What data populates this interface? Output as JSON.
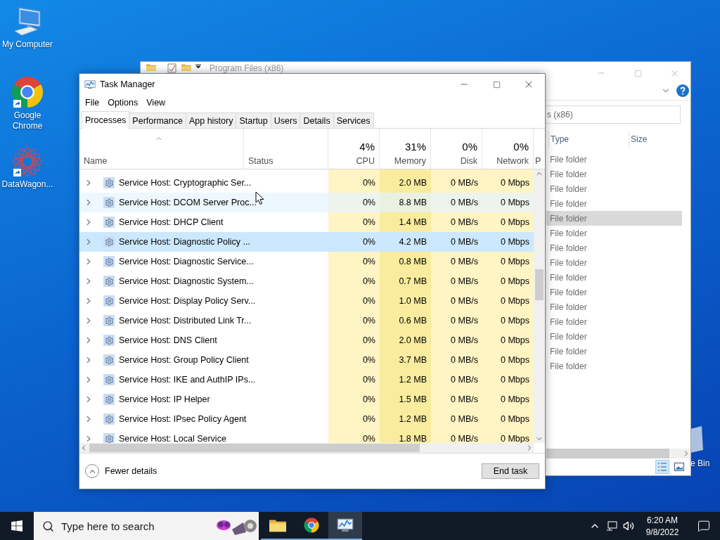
{
  "desktop_icons": [
    {
      "label": "My Computer",
      "kind": "computer"
    },
    {
      "label": "Google Chrome",
      "kind": "chrome"
    },
    {
      "label": "DataWagon...",
      "kind": "app"
    }
  ],
  "recycle_bin": {
    "label": "e Bin"
  },
  "explorer": {
    "title": "Program Files (x86)",
    "address": "s (x86)",
    "columns": [
      "Type",
      "Size"
    ],
    "rows": [
      {
        "type": "File folder",
        "selected": false
      },
      {
        "type": "File folder",
        "selected": false
      },
      {
        "type": "File folder",
        "selected": false
      },
      {
        "type": "File folder",
        "selected": false
      },
      {
        "type": "File folder",
        "selected": true
      },
      {
        "type": "File folder",
        "selected": false
      },
      {
        "type": "File folder",
        "selected": false
      },
      {
        "type": "File folder",
        "selected": false
      },
      {
        "type": "File folder",
        "selected": false
      },
      {
        "type": "File folder",
        "selected": false
      },
      {
        "type": "File folder",
        "selected": false
      },
      {
        "type": "File folder",
        "selected": false
      },
      {
        "type": "File folder",
        "selected": false
      },
      {
        "type": "File folder",
        "selected": false
      },
      {
        "type": "File folder",
        "selected": false
      }
    ]
  },
  "task_manager": {
    "title": "Task Manager",
    "menu": [
      "File",
      "Options",
      "View"
    ],
    "tabs": [
      {
        "label": "Processes",
        "selected": true
      },
      {
        "label": "Performance",
        "selected": false
      },
      {
        "label": "App history",
        "selected": false
      },
      {
        "label": "Startup",
        "selected": false
      },
      {
        "label": "Users",
        "selected": false
      },
      {
        "label": "Details",
        "selected": false
      },
      {
        "label": "Services",
        "selected": false
      }
    ],
    "columns": [
      {
        "label": "Name",
        "kind": "text"
      },
      {
        "label": "Status",
        "kind": "text"
      },
      {
        "label": "CPU",
        "usage": "4%",
        "kind": "metric"
      },
      {
        "label": "Memory",
        "usage": "31%",
        "kind": "metric"
      },
      {
        "label": "Disk",
        "usage": "0%",
        "kind": "metric"
      },
      {
        "label": "Network",
        "usage": "0%",
        "kind": "metric"
      },
      {
        "label": "P",
        "kind": "cut"
      }
    ],
    "rows": [
      {
        "name": "Service Host: Cryptographic Ser...",
        "cpu": "0%",
        "memory": "2.0 MB",
        "disk": "0 MB/s",
        "network": "0 Mbps",
        "selected": false,
        "hovered": false
      },
      {
        "name": "Service Host: DCOM Server Proc...",
        "cpu": "0%",
        "memory": "8.8 MB",
        "disk": "0 MB/s",
        "network": "0 Mbps",
        "selected": false,
        "hovered": true
      },
      {
        "name": "Service Host: DHCP Client",
        "cpu": "0%",
        "memory": "1.4 MB",
        "disk": "0 MB/s",
        "network": "0 Mbps",
        "selected": false,
        "hovered": false
      },
      {
        "name": "Service Host: Diagnostic Policy ...",
        "cpu": "0%",
        "memory": "4.2 MB",
        "disk": "0 MB/s",
        "network": "0 Mbps",
        "selected": true,
        "hovered": false
      },
      {
        "name": "Service Host: Diagnostic Service...",
        "cpu": "0%",
        "memory": "0.8 MB",
        "disk": "0 MB/s",
        "network": "0 Mbps",
        "selected": false,
        "hovered": false
      },
      {
        "name": "Service Host: Diagnostic System...",
        "cpu": "0%",
        "memory": "0.7 MB",
        "disk": "0 MB/s",
        "network": "0 Mbps",
        "selected": false,
        "hovered": false
      },
      {
        "name": "Service Host: Display Policy Serv...",
        "cpu": "0%",
        "memory": "1.0 MB",
        "disk": "0 MB/s",
        "network": "0 Mbps",
        "selected": false,
        "hovered": false
      },
      {
        "name": "Service Host: Distributed Link Tr...",
        "cpu": "0%",
        "memory": "0.6 MB",
        "disk": "0 MB/s",
        "network": "0 Mbps",
        "selected": false,
        "hovered": false
      },
      {
        "name": "Service Host: DNS Client",
        "cpu": "0%",
        "memory": "2.0 MB",
        "disk": "0 MB/s",
        "network": "0 Mbps",
        "selected": false,
        "hovered": false
      },
      {
        "name": "Service Host: Group Policy Client",
        "cpu": "0%",
        "memory": "3.7 MB",
        "disk": "0 MB/s",
        "network": "0 Mbps",
        "selected": false,
        "hovered": false
      },
      {
        "name": "Service Host: IKE and AuthIP IPs...",
        "cpu": "0%",
        "memory": "1.2 MB",
        "disk": "0 MB/s",
        "network": "0 Mbps",
        "selected": false,
        "hovered": false
      },
      {
        "name": "Service Host: IP Helper",
        "cpu": "0%",
        "memory": "1.5 MB",
        "disk": "0 MB/s",
        "network": "0 Mbps",
        "selected": false,
        "hovered": false
      },
      {
        "name": "Service Host: IPsec Policy Agent",
        "cpu": "0%",
        "memory": "1.2 MB",
        "disk": "0 MB/s",
        "network": "0 Mbps",
        "selected": false,
        "hovered": false
      },
      {
        "name": "Service Host: Local Service",
        "cpu": "0%",
        "memory": "1.8 MB",
        "disk": "0 MB/s",
        "network": "0 Mbps",
        "selected": false,
        "hovered": false
      }
    ],
    "footer": {
      "toggle": "Fewer details",
      "button": "End task"
    }
  },
  "taskbar": {
    "search_placeholder": "Type here to search",
    "apps": [
      {
        "kind": "explorer",
        "active": false
      },
      {
        "kind": "chrome",
        "active": false
      },
      {
        "kind": "task_manager",
        "active": true
      }
    ],
    "time": "6:20 AM",
    "date": "9/8/2022"
  }
}
